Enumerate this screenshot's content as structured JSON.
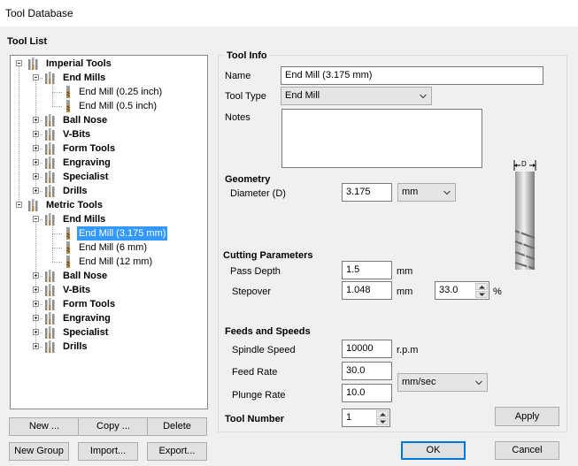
{
  "window": {
    "title": "Tool Database"
  },
  "tool_list": {
    "title": "Tool List",
    "tree": [
      {
        "label": "Imperial Tools",
        "bold": true,
        "expanded": true
      },
      {
        "label": "End Mills",
        "bold": true,
        "expanded": true
      },
      {
        "label": "End Mill (0.25 inch)",
        "bold": false
      },
      {
        "label": "End Mill (0.5 inch)",
        "bold": false
      },
      {
        "label": "Ball Nose",
        "bold": true,
        "expanded": false
      },
      {
        "label": "V-Bits",
        "bold": true,
        "expanded": false
      },
      {
        "label": "Form Tools",
        "bold": true,
        "expanded": false
      },
      {
        "label": "Engraving",
        "bold": true,
        "expanded": false
      },
      {
        "label": "Specialist",
        "bold": true,
        "expanded": false
      },
      {
        "label": "Drills",
        "bold": true,
        "expanded": false
      },
      {
        "label": "Metric Tools",
        "bold": true,
        "expanded": true
      },
      {
        "label": "End Mills",
        "bold": true,
        "expanded": true
      },
      {
        "label": "End Mill (3.175 mm)",
        "bold": false,
        "selected": true
      },
      {
        "label": "End Mill (6 mm)",
        "bold": false
      },
      {
        "label": "End Mill (12 mm)",
        "bold": false
      },
      {
        "label": "Ball Nose",
        "bold": true,
        "expanded": false
      },
      {
        "label": "V-Bits",
        "bold": true,
        "expanded": false
      },
      {
        "label": "Form Tools",
        "bold": true,
        "expanded": false
      },
      {
        "label": "Engraving",
        "bold": true,
        "expanded": false
      },
      {
        "label": "Specialist",
        "bold": true,
        "expanded": false
      },
      {
        "label": "Drills",
        "bold": true,
        "expanded": false
      }
    ],
    "buttons": {
      "new": "New ...",
      "copy": "Copy ...",
      "delete": "Delete",
      "new_group": "New Group",
      "import": "Import...",
      "export": "Export..."
    }
  },
  "tool_info": {
    "title": "Tool Info",
    "name_label": "Name",
    "name_value": "End Mill (3.175 mm)",
    "type_label": "Tool Type",
    "type_value": "End Mill",
    "notes_label": "Notes",
    "notes_value": "",
    "diagram_label": "D"
  },
  "geometry": {
    "title": "Geometry",
    "diameter_label": "Diameter (D)",
    "diameter_value": "3.175",
    "unit_value": "mm"
  },
  "cutting": {
    "title": "Cutting Parameters",
    "pass_depth_label": "Pass Depth",
    "pass_depth_value": "1.5",
    "pass_depth_unit": "mm",
    "stepover_label": "Stepover",
    "stepover_value": "1.048",
    "stepover_unit": "mm",
    "stepover_percent": "33.0",
    "percent_sign": "%"
  },
  "feeds": {
    "title": "Feeds and Speeds",
    "spindle_label": "Spindle Speed",
    "spindle_value": "10000",
    "spindle_unit": "r.p.m",
    "feed_label": "Feed Rate",
    "feed_value": "30.0",
    "plunge_label": "Plunge Rate",
    "plunge_value": "10.0",
    "rate_unit": "mm/sec"
  },
  "tool_number": {
    "label": "Tool Number",
    "value": "1"
  },
  "actions": {
    "apply": "Apply",
    "ok": "OK",
    "cancel": "Cancel"
  },
  "colors": {
    "selection": "#3399ff",
    "primary_border": "#0078d7"
  }
}
